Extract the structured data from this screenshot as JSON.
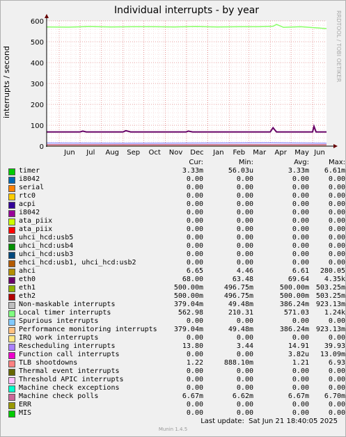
{
  "chart_data": {
    "type": "line",
    "title": "Individual interrupts - by year",
    "ylabel": "interrupts / second",
    "watermark": "RRDTOOL / TOBI OETIKER",
    "ylim": [
      0,
      600
    ],
    "yticks": [
      0,
      100,
      200,
      300,
      400,
      500,
      600
    ],
    "x_ticks": [
      "Jun",
      "Jul",
      "Aug",
      "Sep",
      "Oct",
      "Nov",
      "Dec",
      "Jan",
      "Feb",
      "Mar",
      "Apr",
      "May",
      "Jun"
    ],
    "x_range": [
      "2024-05-14",
      "2025-06-21"
    ],
    "x_tick_dates": [
      "2024-06-01",
      "2024-07-01",
      "2024-08-01",
      "2024-09-01",
      "2024-10-01",
      "2024-11-01",
      "2024-12-01",
      "2025-01-01",
      "2025-02-01",
      "2025-03-01",
      "2025-04-01",
      "2025-05-01",
      "2025-06-01"
    ],
    "grid": true,
    "series": [
      {
        "name": "Local timer interrupts",
        "color": "#88ff66",
        "x": [
          "2024-05-14",
          "2024-06-15",
          "2024-07-15",
          "2024-08-15",
          "2024-09-15",
          "2024-10-15",
          "2024-11-15",
          "2024-12-15",
          "2025-01-15",
          "2025-02-15",
          "2025-03-15",
          "2025-04-05",
          "2025-04-10",
          "2025-04-20",
          "2025-05-15",
          "2025-06-10",
          "2025-06-21"
        ],
        "values": [
          571,
          570,
          573,
          571,
          572,
          572,
          571,
          573,
          571,
          572,
          572,
          574,
          583,
          569,
          572,
          566,
          563
        ]
      },
      {
        "name": "eth0",
        "color": "#660066",
        "x": [
          "2024-05-14",
          "2024-07-01",
          "2024-07-05",
          "2024-07-10",
          "2024-09-01",
          "2024-09-05",
          "2024-09-12",
          "2024-12-01",
          "2024-12-04",
          "2024-12-10",
          "2025-04-01",
          "2025-04-05",
          "2025-04-10",
          "2025-06-01",
          "2025-06-03",
          "2025-06-06",
          "2025-06-21"
        ],
        "values": [
          68,
          68,
          72,
          68,
          68,
          74,
          68,
          68,
          72,
          68,
          68,
          88,
          68,
          68,
          95,
          68,
          68
        ]
      },
      {
        "name": "Rescheduling interrupts",
        "color": "#9999ff",
        "x": [
          "2024-05-14",
          "2024-09-01",
          "2025-01-01",
          "2025-04-01",
          "2025-06-21"
        ],
        "values": [
          15,
          14,
          15,
          16,
          14
        ]
      },
      {
        "name": "Performance monitoring interrupts",
        "color": "#ffcc99",
        "x": [
          "2024-05-14",
          "2024-09-01",
          "2025-01-01",
          "2025-06-21"
        ],
        "values": [
          0.4,
          0.4,
          0.4,
          0.4
        ]
      },
      {
        "name": "ahci",
        "color": "#cc9933",
        "x": [
          "2024-05-14",
          "2024-09-01",
          "2025-01-01",
          "2025-06-21"
        ],
        "values": [
          6.6,
          6.5,
          6.7,
          6.6
        ]
      },
      {
        "name": "Machine check polls",
        "color": "#cc6699",
        "x": [
          "2024-05-14",
          "2025-06-21"
        ],
        "values": [
          6.7,
          6.7
        ]
      }
    ]
  },
  "legend": {
    "headers": [
      "Cur:",
      "Min:",
      "Avg:",
      "Max:"
    ],
    "rows": [
      {
        "name": "timer",
        "color": "#00cc00",
        "cur": "3.33m",
        "min": "56.03u",
        "avg": "3.33m",
        "max": "6.61m"
      },
      {
        "name": "i8042",
        "color": "#0066b3",
        "cur": "0.00",
        "min": "0.00",
        "avg": "0.00",
        "max": "0.00"
      },
      {
        "name": "serial",
        "color": "#ff8000",
        "cur": "0.00",
        "min": "0.00",
        "avg": "0.00",
        "max": "0.00"
      },
      {
        "name": "rtc0",
        "color": "#ffcc00",
        "cur": "0.00",
        "min": "0.00",
        "avg": "0.00",
        "max": "0.00"
      },
      {
        "name": "acpi",
        "color": "#330099",
        "cur": "0.00",
        "min": "0.00",
        "avg": "0.00",
        "max": "0.00"
      },
      {
        "name": "i8042",
        "color": "#990099",
        "cur": "0.00",
        "min": "0.00",
        "avg": "0.00",
        "max": "0.00"
      },
      {
        "name": "ata_piix",
        "color": "#ccff00",
        "cur": "0.00",
        "min": "0.00",
        "avg": "0.00",
        "max": "0.00"
      },
      {
        "name": "ata_piix",
        "color": "#ff0000",
        "cur": "0.00",
        "min": "0.00",
        "avg": "0.00",
        "max": "0.00"
      },
      {
        "name": "uhci_hcd:usb5",
        "color": "#808080",
        "cur": "0.00",
        "min": "0.00",
        "avg": "0.00",
        "max": "0.00"
      },
      {
        "name": "uhci_hcd:usb4",
        "color": "#008f00",
        "cur": "0.00",
        "min": "0.00",
        "avg": "0.00",
        "max": "0.00"
      },
      {
        "name": "uhci_hcd:usb3",
        "color": "#00487d",
        "cur": "0.00",
        "min": "0.00",
        "avg": "0.00",
        "max": "0.00"
      },
      {
        "name": "ehci_hcd:usb1, uhci_hcd:usb2",
        "color": "#b35a00",
        "cur": "0.00",
        "min": "0.00",
        "avg": "0.00",
        "max": "0.00"
      },
      {
        "name": "ahci",
        "color": "#b38f00",
        "cur": "6.65",
        "min": "4.46",
        "avg": "6.61",
        "max": "280.05"
      },
      {
        "name": "eth0",
        "color": "#6b006b",
        "cur": "68.00",
        "min": "63.48",
        "avg": "69.64",
        "max": "4.35k"
      },
      {
        "name": "eth1",
        "color": "#8fb300",
        "cur": "500.00m",
        "min": "496.75m",
        "avg": "500.00m",
        "max": "503.25m"
      },
      {
        "name": "eth2",
        "color": "#b30000",
        "cur": "500.00m",
        "min": "496.75m",
        "avg": "500.00m",
        "max": "503.25m"
      },
      {
        "name": "Non-maskable interrupts",
        "color": "#bebebe",
        "cur": "379.04m",
        "min": "49.48m",
        "avg": "386.24m",
        "max": "923.13m"
      },
      {
        "name": "Local timer interrupts",
        "color": "#80ff80",
        "cur": "562.98",
        "min": "210.31",
        "avg": "571.03",
        "max": "1.24k"
      },
      {
        "name": "Spurious interrupts",
        "color": "#80c9ff",
        "cur": "0.00",
        "min": "0.00",
        "avg": "0.00",
        "max": "0.00"
      },
      {
        "name": "Performance monitoring interrupts",
        "color": "#ffc080",
        "cur": "379.04m",
        "min": "49.48m",
        "avg": "386.24m",
        "max": "923.13m"
      },
      {
        "name": "IRQ work interrupts",
        "color": "#ffe680",
        "cur": "0.00",
        "min": "0.00",
        "avg": "0.00",
        "max": "0.00"
      },
      {
        "name": "Rescheduling interrupts",
        "color": "#aa80ff",
        "cur": "13.80",
        "min": "3.44",
        "avg": "14.91",
        "max": "39.93"
      },
      {
        "name": "Function call interrupts",
        "color": "#ee00cc",
        "cur": "0.00",
        "min": "0.00",
        "avg": "3.82u",
        "max": "13.09m"
      },
      {
        "name": "TLB shootdowns",
        "color": "#ff8080",
        "cur": "1.22",
        "min": "888.10m",
        "avg": "1.21",
        "max": "6.93"
      },
      {
        "name": "Thermal event interrupts",
        "color": "#666600",
        "cur": "0.00",
        "min": "0.00",
        "avg": "0.00",
        "max": "0.00"
      },
      {
        "name": "Threshold APIC interrupts",
        "color": "#ffbfff",
        "cur": "0.00",
        "min": "0.00",
        "avg": "0.00",
        "max": "0.00"
      },
      {
        "name": "Machine check exceptions",
        "color": "#00ffcc",
        "cur": "0.00",
        "min": "0.00",
        "avg": "0.00",
        "max": "0.00"
      },
      {
        "name": "Machine check polls",
        "color": "#cc6699",
        "cur": "6.67m",
        "min": "6.62m",
        "avg": "6.67m",
        "max": "6.70m"
      },
      {
        "name": "ERR",
        "color": "#999900",
        "cur": "0.00",
        "min": "0.00",
        "avg": "0.00",
        "max": "0.00"
      },
      {
        "name": "MIS",
        "color": "#00cc00",
        "cur": "0.00",
        "min": "0.00",
        "avg": "0.00",
        "max": "0.00"
      }
    ]
  },
  "footer": {
    "last_update": "Last update:  Sat Jun 21 18:40:05 2025",
    "version": "Munin 1.4.5"
  }
}
